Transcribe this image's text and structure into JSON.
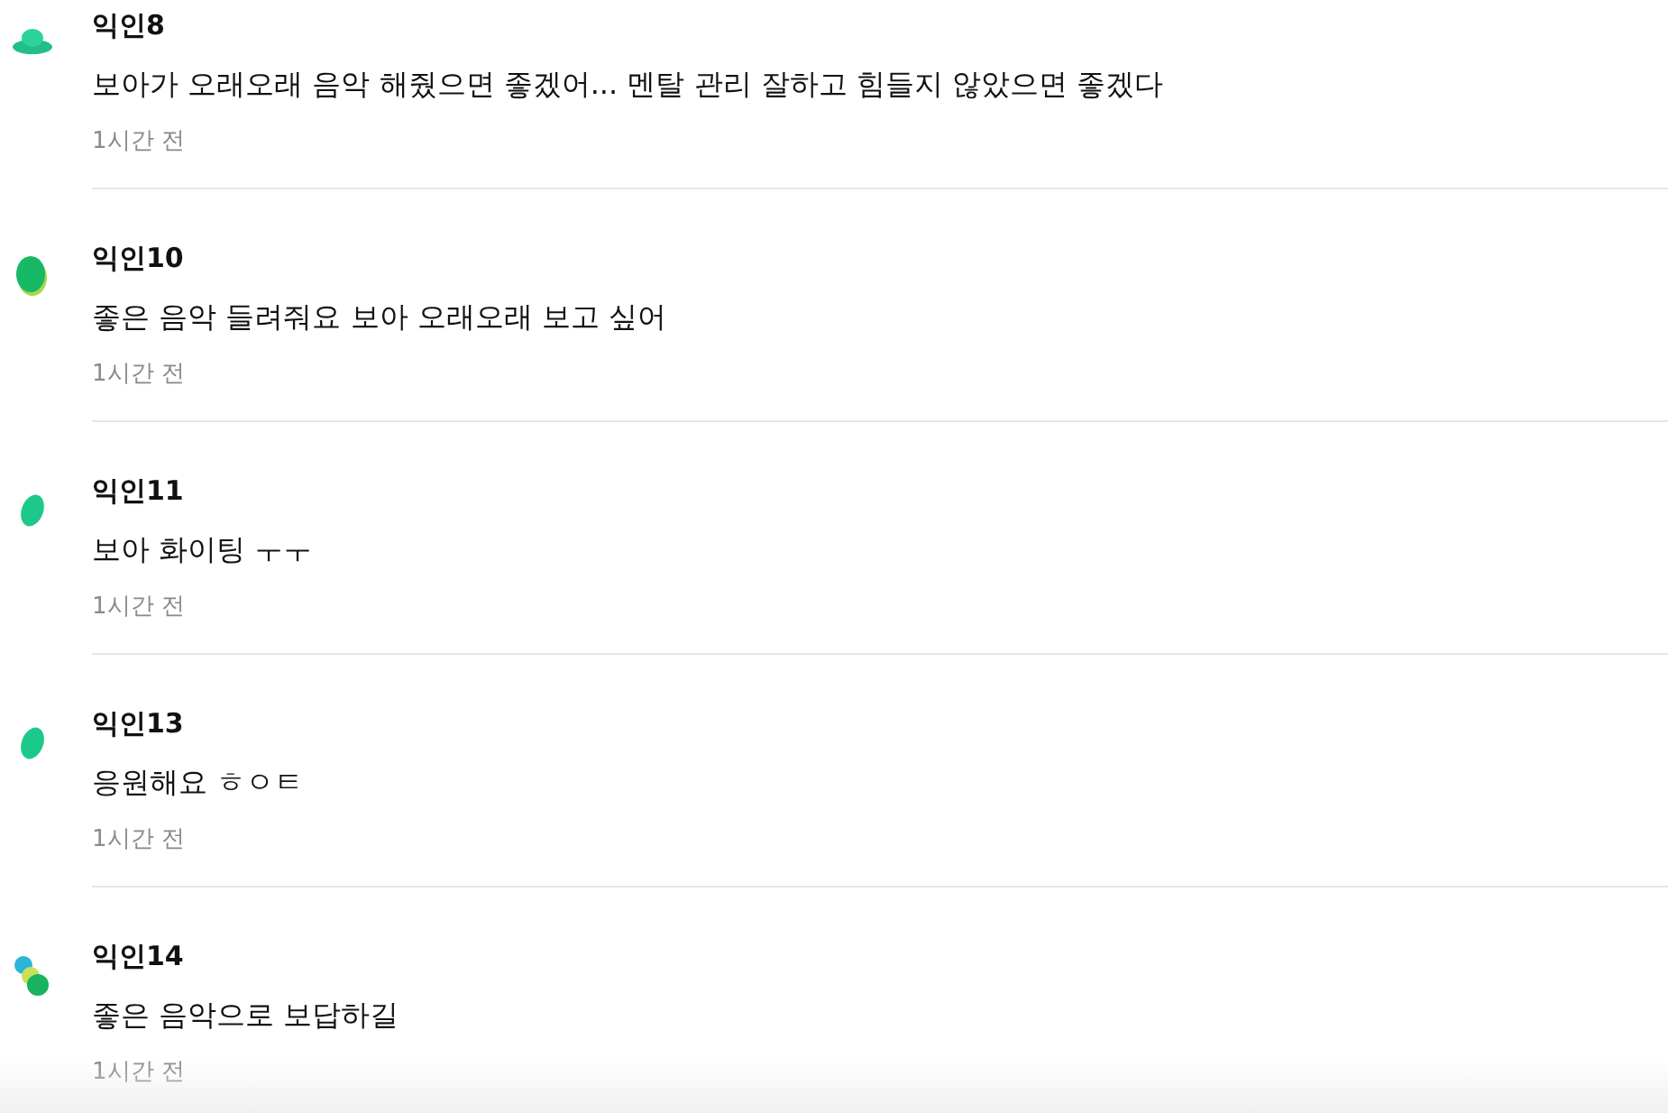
{
  "comments": [
    {
      "author": "익인8",
      "text": "보아가 오래오래 음악 해줬으면 좋겠어... 멘탈 관리 잘하고 힘들지 않았으면 좋겠다",
      "time": "1시간 전",
      "avatar": {
        "kind": "hat"
      }
    },
    {
      "author": "익인10",
      "text": "좋은 음악 들려줘요 보아 오래오래 보고 싶어",
      "time": "1시간 전",
      "avatar": {
        "kind": "disc"
      }
    },
    {
      "author": "익인11",
      "text": "보아 화이팅 ㅜㅜ",
      "time": "1시간 전",
      "avatar": {
        "kind": "leaf"
      }
    },
    {
      "author": "익인13",
      "text": "응원해요 ㅎㅇㅌ",
      "time": "1시간 전",
      "avatar": {
        "kind": "leaf"
      }
    },
    {
      "author": "익인14",
      "text": "좋은 음악으로 보답하길",
      "time": "1시간 전",
      "avatar": {
        "kind": "dots"
      }
    }
  ]
}
